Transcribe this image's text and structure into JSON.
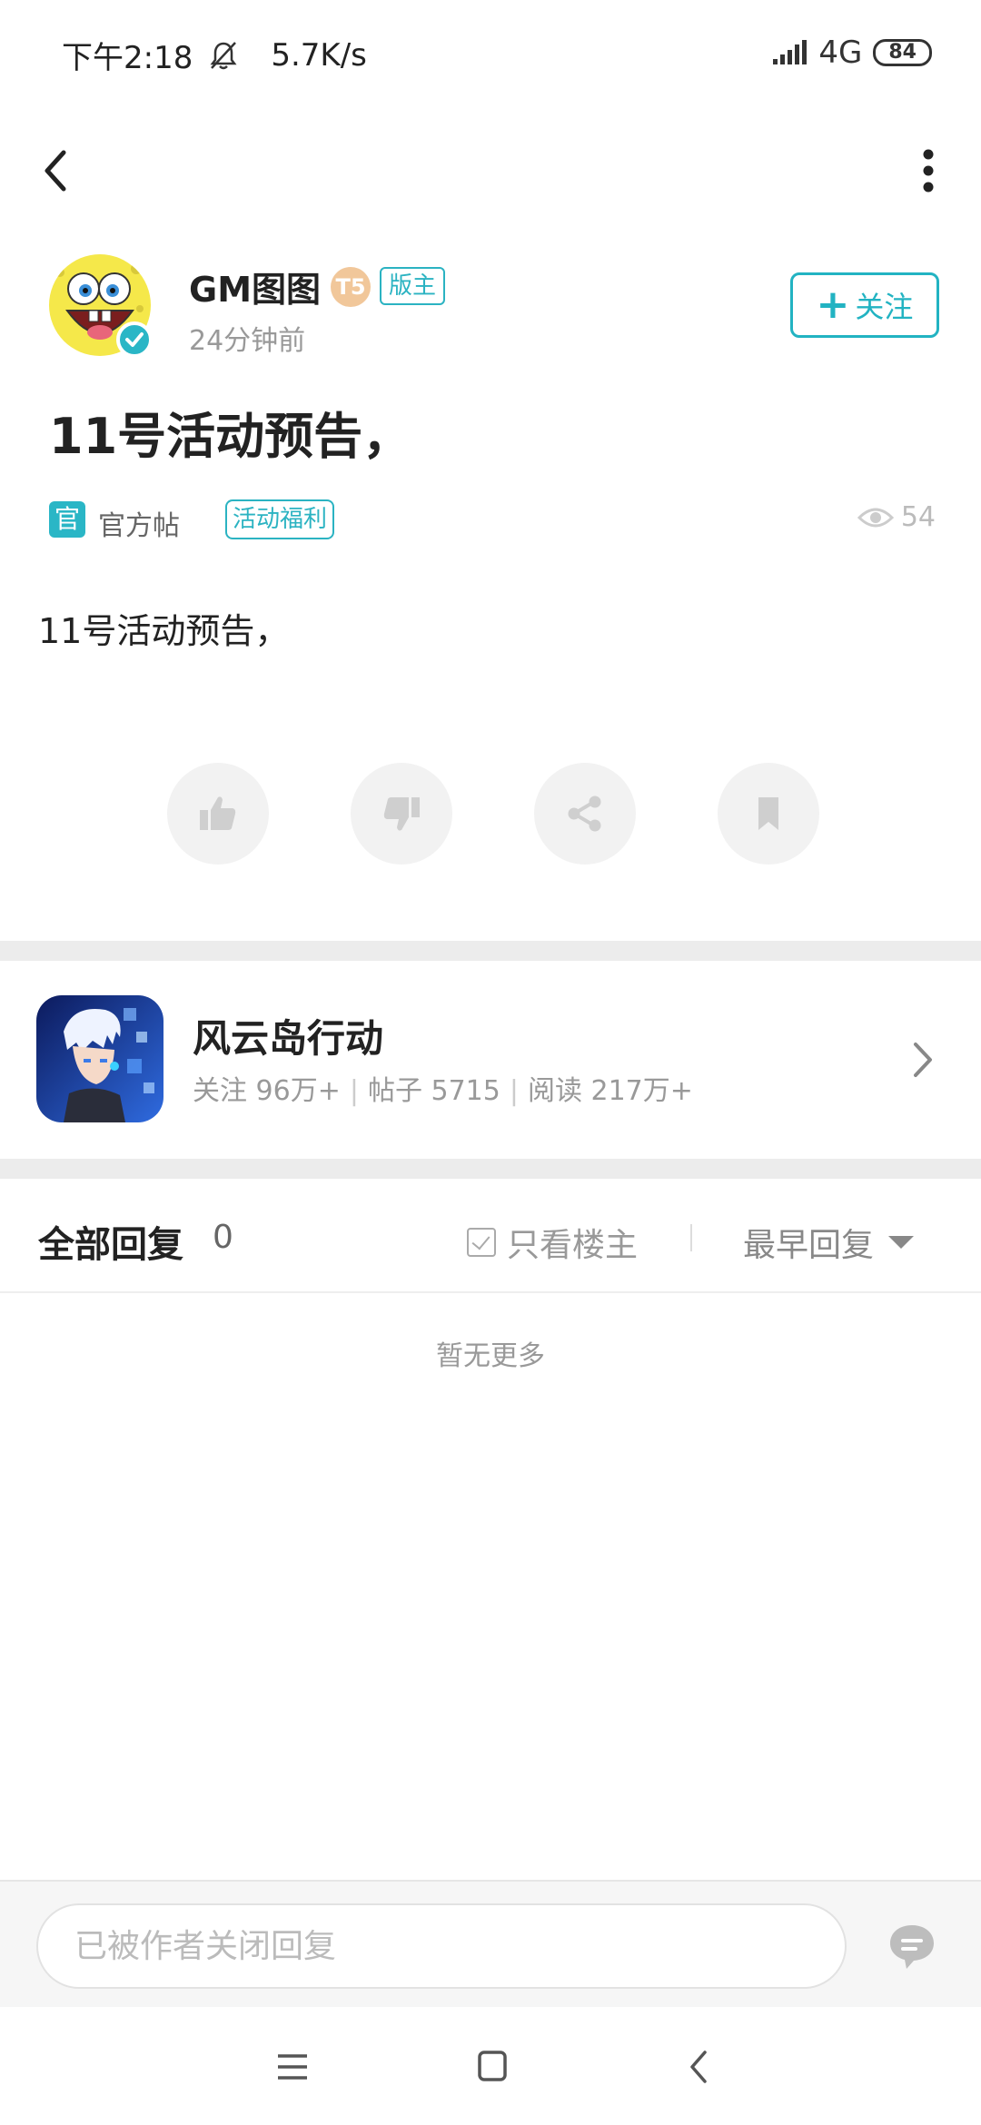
{
  "status_bar": {
    "time": "下午2:18",
    "speed": "5.7K/s",
    "network": "4G",
    "battery": "84"
  },
  "post": {
    "author_name": "GM图图",
    "level_badge": "T5",
    "role_badge": "版主",
    "time_ago": "24分钟前",
    "follow_label": "关注",
    "title": "11号活动预告，",
    "official_tag": "官",
    "official_label": "官方帖",
    "topic_tag": "活动福利",
    "view_count": "54",
    "body": "11号活动预告，"
  },
  "forum": {
    "name": "风云岛行动",
    "stats": {
      "follow": "关注 96万+",
      "posts": "帖子 5715",
      "reads": "阅读 217万+",
      "separator": "|"
    }
  },
  "replies": {
    "title": "全部回复",
    "count": "0",
    "only_op_label": "只看楼主",
    "sort_label": "最早回复",
    "empty_text": "暂无更多"
  },
  "bottom_bar": {
    "input_placeholder": "已被作者关闭回复"
  },
  "colors": {
    "accent": "#22b3c2",
    "muted": "#999999",
    "divider": "#ececec"
  }
}
